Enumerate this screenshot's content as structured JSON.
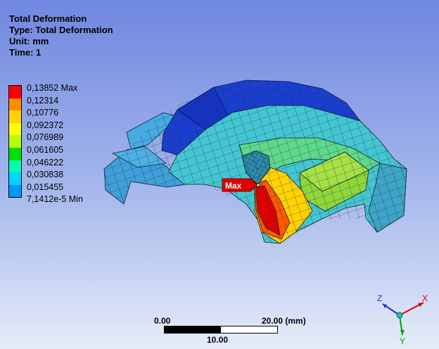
{
  "result": {
    "title": "Total Deformation",
    "type_line": "Type: Total Deformation",
    "unit_line": "Unit: mm",
    "time_line": "Time: 1"
  },
  "legend": {
    "labels": [
      "0,13852 Max",
      "0,12314",
      "0,10776",
      "0,092372",
      "0,076989",
      "0,061605",
      "0,046222",
      "0,030838",
      "0,015455",
      "7,1412e-5 Min"
    ],
    "colors": [
      "#ff0000",
      "#ff8c00",
      "#ffd200",
      "#ffff00",
      "#b4ff00",
      "#00e100",
      "#00ffb4",
      "#00d2ff",
      "#0096ff",
      "#0000ff"
    ]
  },
  "probe": {
    "label": "Max"
  },
  "scale_bar": {
    "left_label": "0.00",
    "right_label": "20.00 (mm)",
    "mid_label": "10.00"
  },
  "triad": {
    "x_label": "X",
    "y_label": "Y",
    "z_label": "Z"
  }
}
